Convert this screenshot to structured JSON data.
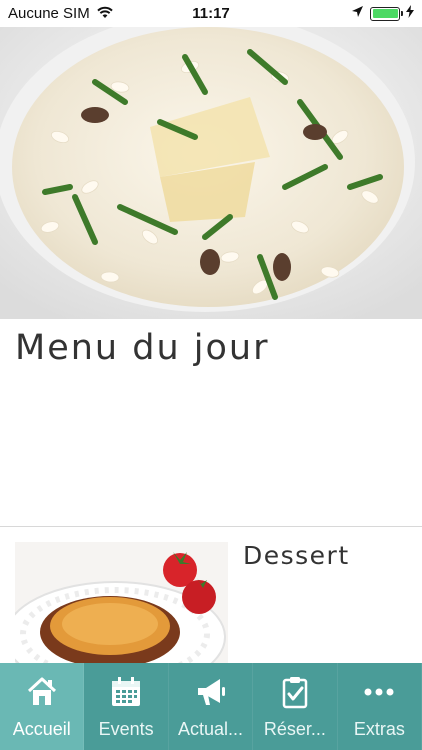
{
  "status_bar": {
    "carrier": "Aucune SIM",
    "time": "11:17",
    "battery_color": "#4cd964"
  },
  "hero": {
    "image": "risotto-dish-image"
  },
  "page": {
    "title": "Menu du jour"
  },
  "menu_items": [
    {
      "label": "Dessert",
      "image": "creme-brulee-image"
    }
  ],
  "tab_bar": {
    "background": "#4a9c98",
    "active_background": "#6ab8b4",
    "tabs": [
      {
        "label": "Accueil",
        "icon": "home-icon",
        "active": true
      },
      {
        "label": "Events",
        "icon": "calendar-icon",
        "active": false
      },
      {
        "label": "Actual...",
        "icon": "megaphone-icon",
        "active": false
      },
      {
        "label": "Réser...",
        "icon": "clipboard-check-icon",
        "active": false
      },
      {
        "label": "Extras",
        "icon": "more-icon",
        "active": false
      }
    ]
  }
}
